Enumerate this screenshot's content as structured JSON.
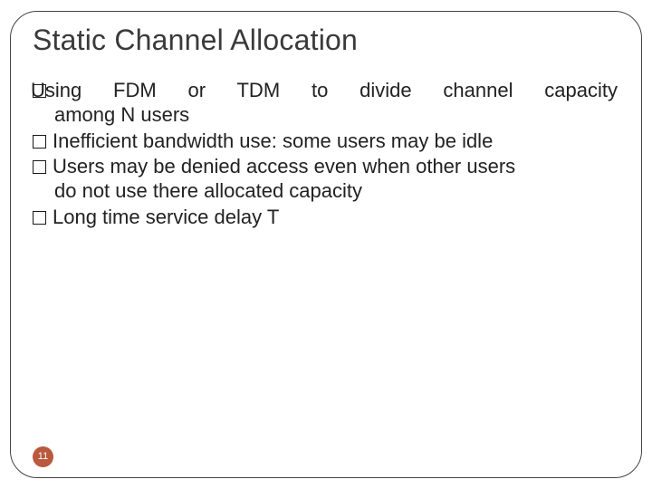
{
  "slide": {
    "title": "Static Channel Allocation",
    "items": [
      {
        "line1": "Using  FDM  or  TDM  to  divide  channel  capacity",
        "rest": "among N users",
        "justify": true
      },
      {
        "line1": "Inefficient bandwidth use: some users may be idle",
        "rest": "",
        "justify": false
      },
      {
        "line1": "Users may be denied access even when other users",
        "rest": "do not use there allocated capacity",
        "justify": false
      },
      {
        "line1": "Long time service delay T",
        "rest": "",
        "justify": false
      }
    ],
    "page_number": "11"
  }
}
